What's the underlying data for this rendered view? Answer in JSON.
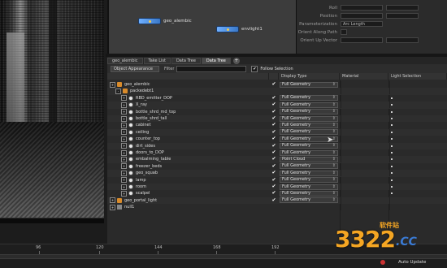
{
  "network": {
    "nodes": [
      {
        "label": "geo_alembic"
      },
      {
        "label": "envlight1"
      }
    ]
  },
  "params": {
    "rows": [
      {
        "label": "Roll",
        "value": ""
      },
      {
        "label": "Position",
        "value": ""
      },
      {
        "label": "Parameterization",
        "value": "Arc Length"
      },
      {
        "label": "Orient Along Path",
        "value": ""
      },
      {
        "label": "Orient Up Vector",
        "value": ""
      }
    ]
  },
  "tabs": [
    {
      "label": "geo_alembic"
    },
    {
      "label": "Take List"
    },
    {
      "label": "Data Tree"
    },
    {
      "label": "Data Tree"
    }
  ],
  "tab_add": "+",
  "toolbar": {
    "mode": "Object Appearance",
    "filter_label": "Filter",
    "follow_label": "Follow Selection",
    "follow_checked": "✔"
  },
  "tree": {
    "headers": [
      "Display Type",
      "Material",
      "Light Selection"
    ],
    "rows": [
      {
        "name": "geo_alembic",
        "level": 0,
        "icon": "geo",
        "expander": "+",
        "visible": "✔",
        "display": "Full Geometry",
        "light": false
      },
      {
        "name": "packedebt1",
        "level": 1,
        "icon": "geo",
        "expander": "-",
        "visible": "",
        "display": "",
        "light": false
      },
      {
        "name": "RBD_emitter_DOP",
        "level": 2,
        "icon": "obj",
        "expander": "+",
        "visible": "✔",
        "display": "Full Geometry",
        "light": true
      },
      {
        "name": "X_ray",
        "level": 2,
        "icon": "obj",
        "expander": "+",
        "visible": "✔",
        "display": "Full Geometry",
        "light": true
      },
      {
        "name": "bottle_shrd_md_top",
        "level": 2,
        "icon": "obj",
        "expander": "+",
        "visible": "✔",
        "display": "Full Geometry",
        "light": true
      },
      {
        "name": "bottle_shrd_tall",
        "level": 2,
        "icon": "obj",
        "expander": "+",
        "visible": "✔",
        "display": "Full Geometry",
        "light": true
      },
      {
        "name": "cabinet",
        "level": 2,
        "icon": "obj",
        "expander": "+",
        "visible": "✔",
        "display": "Full Geometry",
        "light": true
      },
      {
        "name": "ceiling",
        "level": 2,
        "icon": "obj",
        "expander": "+",
        "visible": "✔",
        "display": "Full Geometry",
        "light": true
      },
      {
        "name": "counter_top",
        "level": 2,
        "icon": "obj",
        "expander": "+",
        "visible": "✔",
        "display": "Full Geometry",
        "light": true
      },
      {
        "name": "dirt_sides",
        "level": 2,
        "icon": "obj",
        "expander": "+",
        "visible": "✔",
        "display": "Full Geometry",
        "light": true
      },
      {
        "name": "doors_to_DOP",
        "level": 2,
        "icon": "obj",
        "expander": "+",
        "visible": "✔",
        "display": "Full Geometry",
        "light": true
      },
      {
        "name": "embalming_table",
        "level": 2,
        "icon": "obj",
        "expander": "+",
        "visible": "✔",
        "display": "Point Cloud",
        "light": true
      },
      {
        "name": "freezer_beds",
        "level": 2,
        "icon": "obj",
        "expander": "+",
        "visible": "✔",
        "display": "Full Geometry",
        "light": true
      },
      {
        "name": "geo_squab",
        "level": 2,
        "icon": "obj",
        "expander": "+",
        "visible": "✔",
        "display": "Full Geometry",
        "light": true
      },
      {
        "name": "lamp",
        "level": 2,
        "icon": "obj",
        "expander": "+",
        "visible": "✔",
        "display": "Full Geometry",
        "light": true
      },
      {
        "name": "room",
        "level": 2,
        "icon": "obj",
        "expander": "+",
        "visible": "✔",
        "display": "Full Geometry",
        "light": true
      },
      {
        "name": "scalpel",
        "level": 2,
        "icon": "obj",
        "expander": "+",
        "visible": "✔",
        "display": "Full Geometry",
        "light": true
      },
      {
        "name": "geo_portal_light",
        "level": 0,
        "icon": "geo",
        "expander": "+",
        "visible": "✔",
        "display": "Full Geometry",
        "light": false
      },
      {
        "name": "null1",
        "level": 0,
        "icon": "null",
        "expander": "+",
        "visible": "",
        "display": "",
        "light": false
      }
    ]
  },
  "timeline": {
    "ticks": [
      "96",
      "120",
      "144",
      "168",
      "192"
    ],
    "auto_update": "Auto Update"
  },
  "watermark": {
    "main": "3322",
    "sub": "软件站",
    "domain": ".CC"
  }
}
